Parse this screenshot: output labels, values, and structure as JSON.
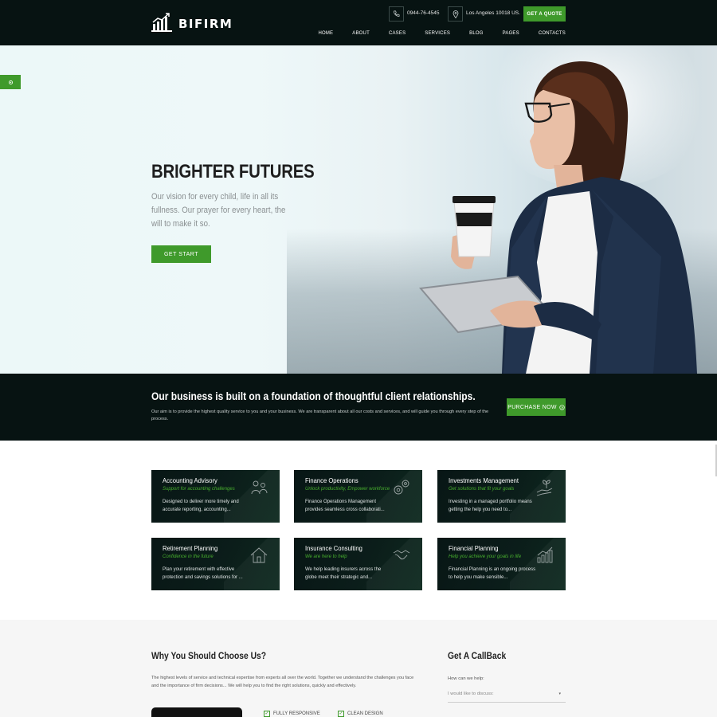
{
  "header": {
    "logo_text": "BIFIRM",
    "phone": "0944-76-4545",
    "location": "Los Angeles 10018 US.",
    "quote_label": "GET A QUOTE",
    "nav": [
      "HOME",
      "ABOUT",
      "CASES",
      "SERVICES",
      "BLOG",
      "PAGES",
      "CONTACTS"
    ]
  },
  "hero": {
    "title": "BRIGHTER FUTURES",
    "text": "Our vision for every child, life in all its fullness. Our prayer for every heart, the will to make it so.",
    "button": "GET START"
  },
  "band": {
    "title": "Our business is built on a foundation of thoughtful client relationships.",
    "text": "Our aim is to provide the highest quality service to you and your business. We are transparent about all our costs and services, and will guide you through every step of the process.",
    "button": "PURCHASE NOW"
  },
  "services": [
    {
      "title": "Accounting Advisory",
      "subtitle": "Support for accounting challenges",
      "desc": "Designed to deliver more timely and accurate reporting, accounting...",
      "icon": "people-icon"
    },
    {
      "title": "Finance Operations",
      "subtitle": "Unlock productivity, Empower workforce",
      "desc": "Finance Operations Management provides seamless cross collaborati...",
      "icon": "gears-icon"
    },
    {
      "title": "Investments Management",
      "subtitle": "Get solutions that fit your goals",
      "desc": "Investing in a managed portfolio means getting the help you need to...",
      "icon": "hand-plant-icon"
    },
    {
      "title": "Retirement Planning",
      "subtitle": "Confidence in the future",
      "desc": "Plan your retirement with effective protection and savings solutions for ...",
      "icon": "house-icon"
    },
    {
      "title": "Insurance Consulting",
      "subtitle": "We are here to help",
      "desc": "We help leading insurers across the globe meet their strategic and...",
      "icon": "handshake-icon"
    },
    {
      "title": "Financial Planning",
      "subtitle": "Help you achieve your goals in life",
      "desc": "Financial Planning is an ongoing process to help you make sensible...",
      "icon": "chart-icon"
    }
  ],
  "why": {
    "title": "Why You Should Choose Us?",
    "text": "The highest levels of service and technical expertise from experts all over the world. Together we understand the challenges you face and the importance of firm decisions... We will help you to find the right solutions, quickly and effectively.",
    "features": [
      "FULLY RESPONSIVE",
      "CLEAN DESIGN"
    ]
  },
  "callback": {
    "title": "Get A CallBack",
    "label": "How can we help:",
    "select_value": "I would like to discuss:"
  },
  "colors": {
    "accent": "#3f9a2b",
    "dark": "#071312",
    "accent_text": "#48b02e"
  }
}
